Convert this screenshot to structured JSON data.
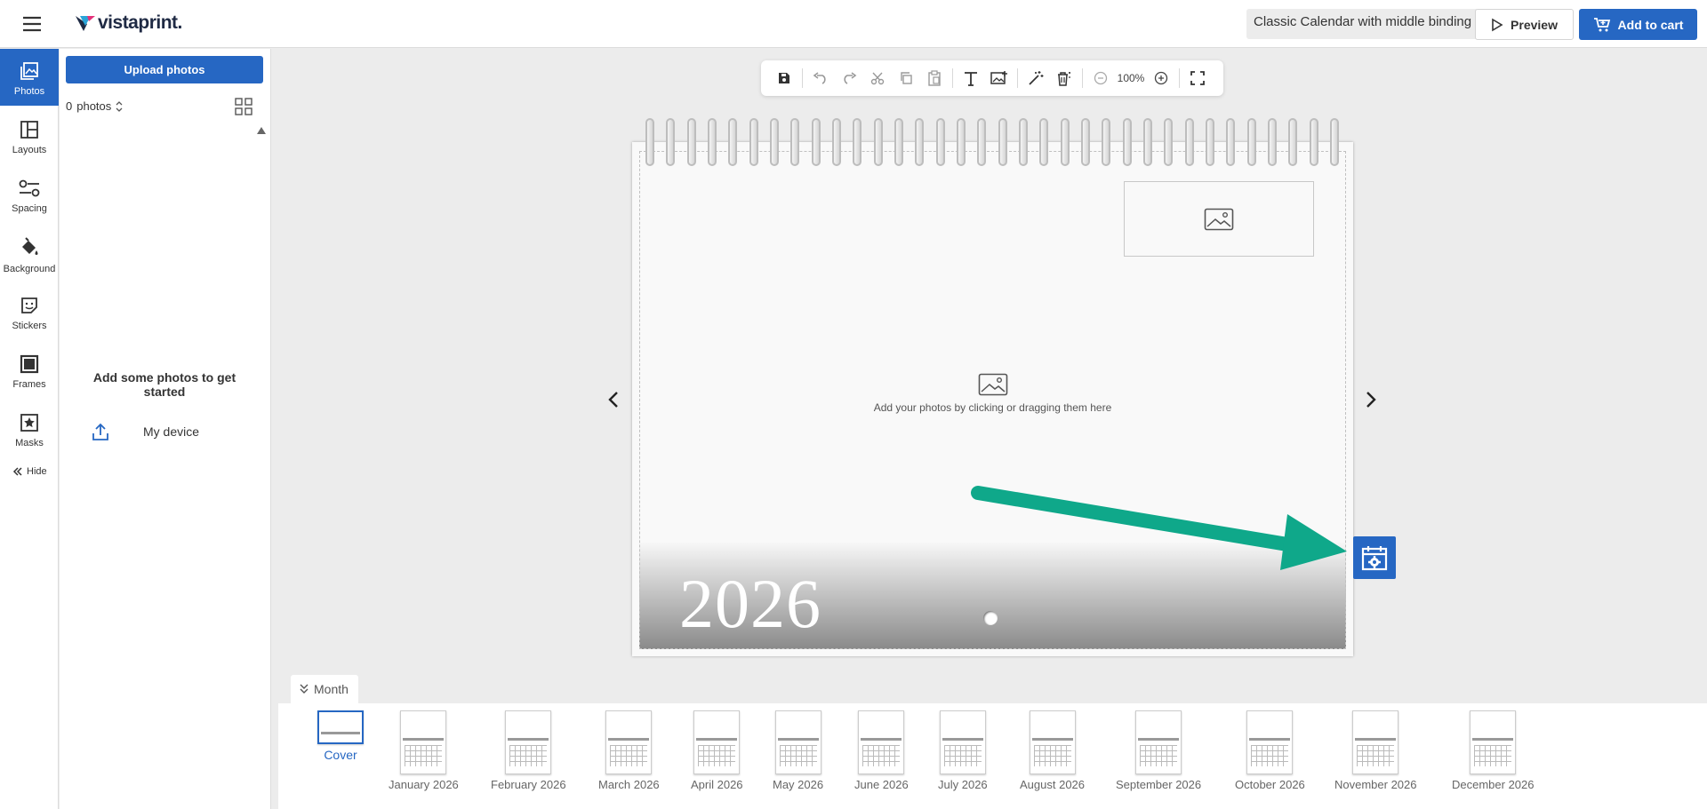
{
  "header": {
    "logo_text": "vistaprint.",
    "product_name": "Classic Calendar with middle binding",
    "preview_label": "Preview",
    "cart_label": "Add to cart"
  },
  "rail": {
    "items": [
      {
        "label": "Photos",
        "icon": "photos-icon"
      },
      {
        "label": "Layouts",
        "icon": "layouts-icon"
      },
      {
        "label": "Spacing",
        "icon": "spacing-icon"
      },
      {
        "label": "Background",
        "icon": "paint-bucket-icon"
      },
      {
        "label": "Stickers",
        "icon": "sticker-icon"
      },
      {
        "label": "Frames",
        "icon": "frame-icon"
      },
      {
        "label": "Masks",
        "icon": "mask-icon"
      }
    ],
    "hide_label": "Hide"
  },
  "panel": {
    "upload_label": "Upload photos",
    "count_value": "0",
    "count_unit": "photos",
    "empty_title": "Add some photos to get started",
    "my_device_label": "My device"
  },
  "toolbar": {
    "zoom": "100%"
  },
  "canvas": {
    "year": "2026",
    "photo_hint": "Add your photos by clicking or dragging them here"
  },
  "strip": {
    "month_tab_label": "Month",
    "pages": [
      {
        "label": "Cover"
      },
      {
        "label": "January 2026"
      },
      {
        "label": "February 2026"
      },
      {
        "label": "March 2026"
      },
      {
        "label": "April 2026"
      },
      {
        "label": "May 2026"
      },
      {
        "label": "June 2026"
      },
      {
        "label": "July 2026"
      },
      {
        "label": "August 2026"
      },
      {
        "label": "September 2026"
      },
      {
        "label": "October 2026"
      },
      {
        "label": "November 2026"
      },
      {
        "label": "December 2026"
      }
    ]
  },
  "colors": {
    "accent": "#2667c3",
    "annotation_arrow": "#0fa88a"
  }
}
